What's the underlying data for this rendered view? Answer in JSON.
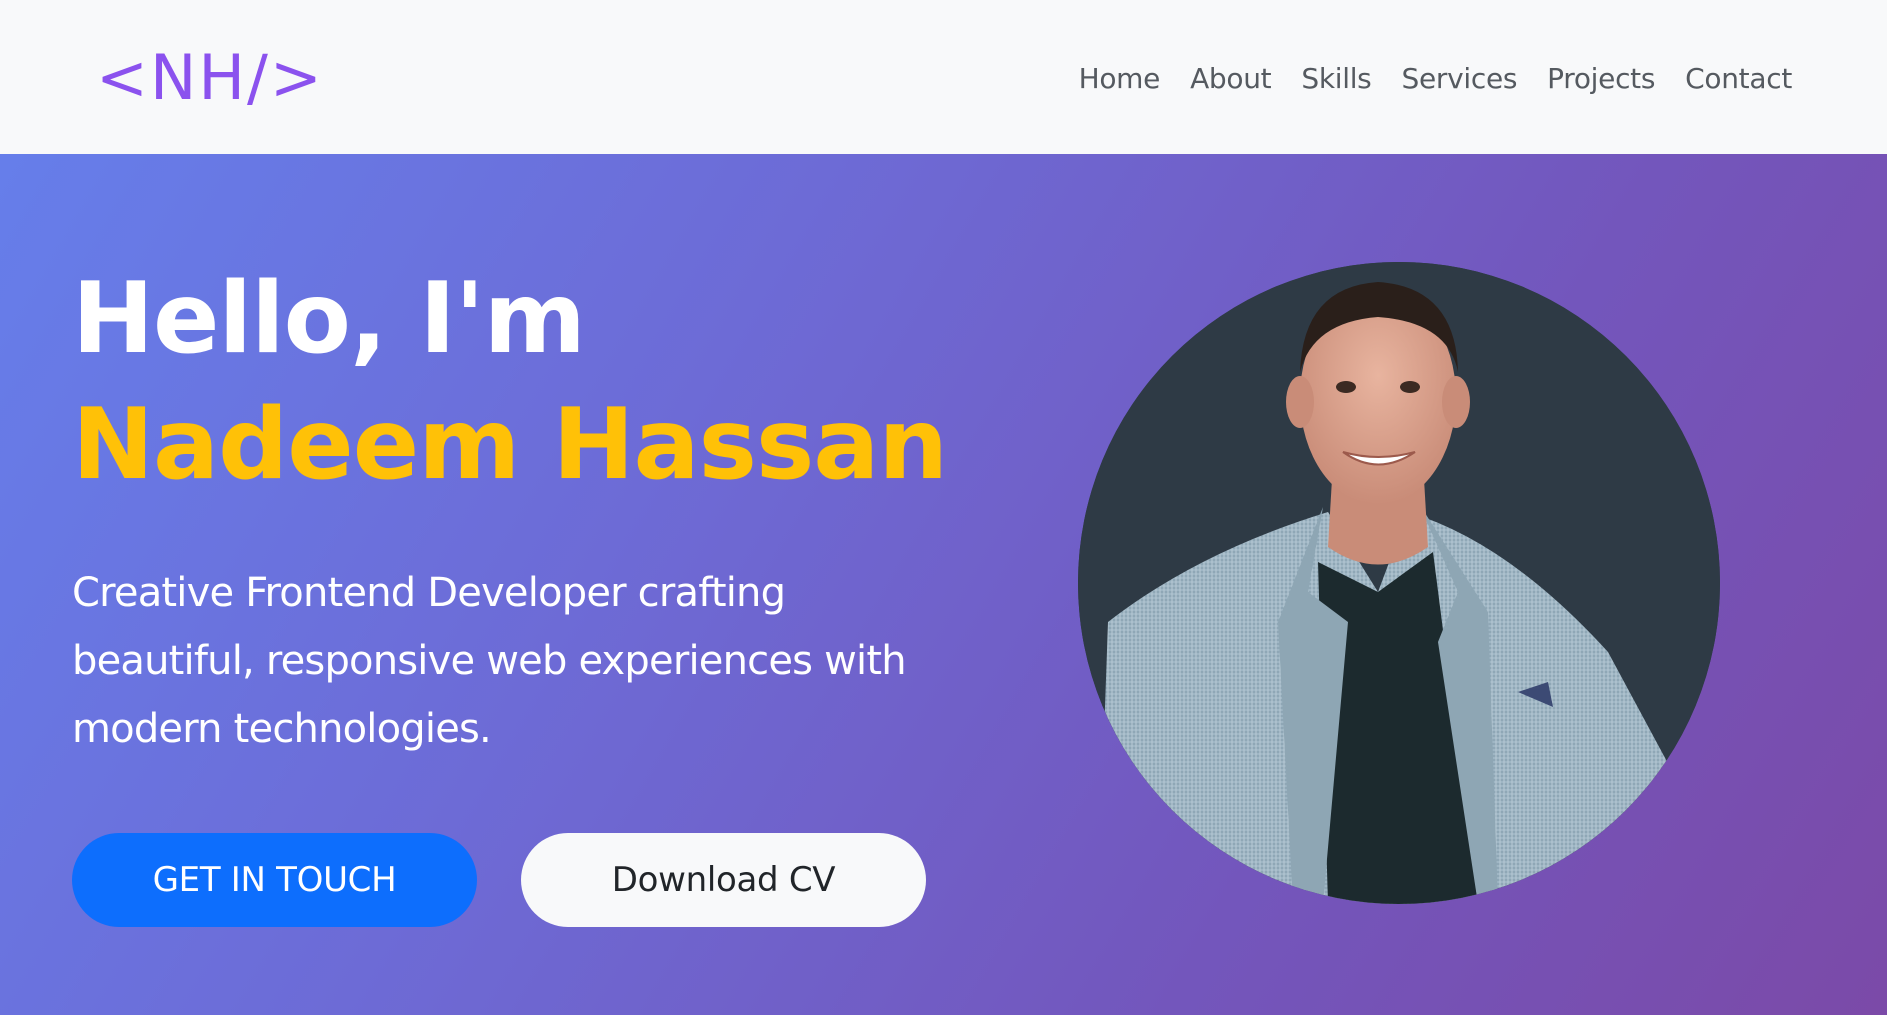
{
  "nav": {
    "logo": "<NH/>",
    "links": [
      "Home",
      "About",
      "Skills",
      "Services",
      "Projects",
      "Contact"
    ]
  },
  "hero": {
    "greeting": "Hello, I'm",
    "name": "Nadeem Hassan",
    "tagline": "Creative Frontend Developer crafting beautiful, responsive web experiences with modern technologies.",
    "primary_button": "GET IN TOUCH",
    "secondary_button": "Download CV"
  },
  "colors": {
    "logo": "#8b52ee",
    "name_accent": "#ffc107",
    "primary_button": "#0d6efd",
    "hero_gradient_start": "#667eea",
    "hero_gradient_end": "#7b4aa8",
    "avatar_background": "#2e3a45"
  }
}
